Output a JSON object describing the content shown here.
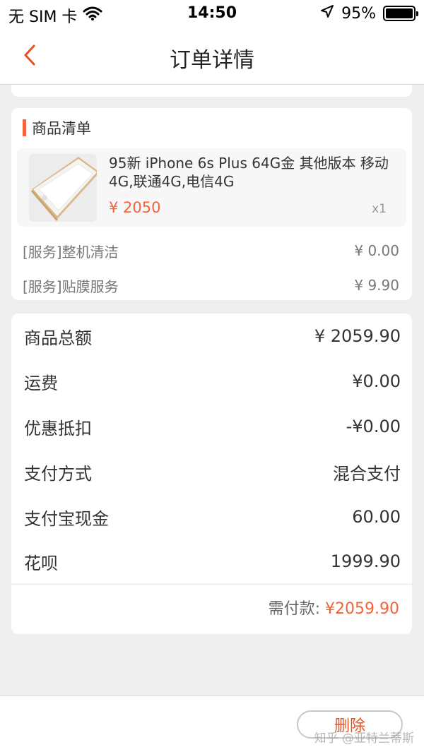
{
  "status_bar": {
    "carrier": "无 SIM 卡",
    "time": "14:50",
    "battery": "95%"
  },
  "nav": {
    "title": "订单详情"
  },
  "goods": {
    "section_title": "商品清单",
    "item": {
      "name": "95新 iPhone 6s Plus 64G金 其他版本 移动4G,联通4G,电信4G",
      "price": "¥ 2050",
      "quantity": "x1"
    },
    "services": [
      {
        "label": "[服务]整机清洁",
        "price": "¥ 0.00"
      },
      {
        "label": "[服务]贴膜服务",
        "price": "¥ 9.90"
      }
    ]
  },
  "summary": {
    "rows": [
      {
        "label": "商品总额",
        "value": "¥ 2059.90"
      },
      {
        "label": "运费",
        "value": "¥0.00"
      },
      {
        "label": "优惠抵扣",
        "value": "-¥0.00"
      },
      {
        "label": "支付方式",
        "value": "混合支付"
      },
      {
        "label": "支付宝现金",
        "value": "60.00"
      },
      {
        "label": "花呗",
        "value": "1999.90"
      }
    ],
    "total_label": "需付款: ",
    "total_value": "¥2059.90"
  },
  "footer": {
    "delete_label": "删除",
    "watermark": "知乎 @亚特兰蒂斯"
  },
  "colors": {
    "accent": "#f4633a",
    "background": "#efefef"
  }
}
